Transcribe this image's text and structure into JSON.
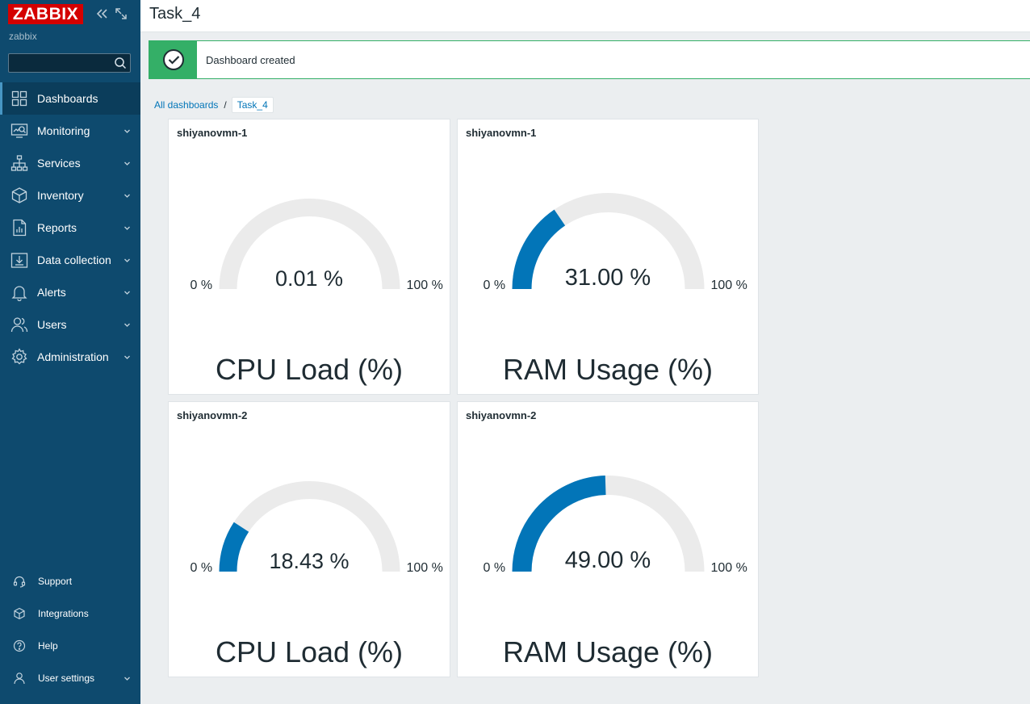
{
  "brand": {
    "logo_text": "ZABBIX",
    "instance": "zabbix",
    "logo_color": "#d40000"
  },
  "colors": {
    "sidebar": "#0e4a6e",
    "gauge_fill": "#0275b8",
    "gauge_track": "#ebebeb",
    "success": "#34af67",
    "link": "#0275b8"
  },
  "sidebar": {
    "controls": {
      "collapse_icon": "double-chevron-left-icon",
      "kiosk_icon": "expand-icon"
    },
    "search": {
      "value": "",
      "placeholder": ""
    },
    "items": [
      {
        "label": "Dashboards",
        "icon": "dashboard-icon",
        "active": true,
        "has_menu": false
      },
      {
        "label": "Monitoring",
        "icon": "monitoring-icon",
        "active": false,
        "has_menu": true
      },
      {
        "label": "Services",
        "icon": "services-icon",
        "active": false,
        "has_menu": true
      },
      {
        "label": "Inventory",
        "icon": "inventory-icon",
        "active": false,
        "has_menu": true
      },
      {
        "label": "Reports",
        "icon": "reports-icon",
        "active": false,
        "has_menu": true
      },
      {
        "label": "Data collection",
        "icon": "data-collection-icon",
        "active": false,
        "has_menu": true
      },
      {
        "label": "Alerts",
        "icon": "bell-icon",
        "active": false,
        "has_menu": true
      },
      {
        "label": "Users",
        "icon": "users-icon",
        "active": false,
        "has_menu": true
      },
      {
        "label": "Administration",
        "icon": "gear-icon",
        "active": false,
        "has_menu": true
      }
    ],
    "bottom_items": [
      {
        "label": "Support",
        "icon": "headset-icon",
        "has_menu": false
      },
      {
        "label": "Integrations",
        "icon": "integrations-icon",
        "has_menu": false
      },
      {
        "label": "Help",
        "icon": "help-icon",
        "has_menu": false
      },
      {
        "label": "User settings",
        "icon": "user-icon",
        "has_menu": true
      }
    ]
  },
  "header": {
    "title": "Task_4"
  },
  "message": {
    "text": "Dashboard created",
    "icon": "check-circle-icon"
  },
  "breadcrumb": {
    "parent": "All dashboards",
    "current": "Task_4"
  },
  "widgets": [
    {
      "host": "shiyanovmn-1",
      "value": 0.01,
      "value_text": "0.01 %",
      "min_label": "0 %",
      "max_label": "100 %",
      "description": "CPU Load (%)"
    },
    {
      "host": "shiyanovmn-1",
      "value": 31,
      "value_text": "31.00 %",
      "min_label": "0 %",
      "max_label": "100 %",
      "description": "RAM Usage (%)"
    },
    {
      "host": "shiyanovmn-2",
      "value": 18.43,
      "value_text": "18.43 %",
      "min_label": "0 %",
      "max_label": "100 %",
      "description": "CPU Load (%)"
    },
    {
      "host": "shiyanovmn-2",
      "value": 49,
      "value_text": "49.00 %",
      "min_label": "0 %",
      "max_label": "100 %",
      "description": "RAM Usage (%)"
    }
  ]
}
